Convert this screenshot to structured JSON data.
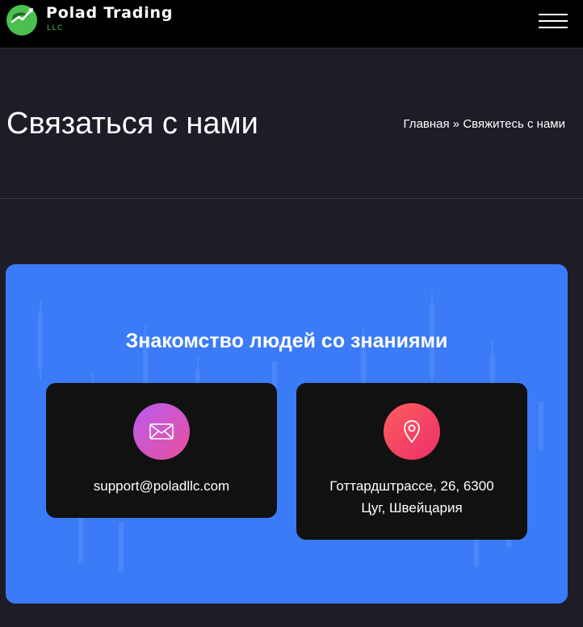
{
  "header": {
    "brand_name": "Polad Trading",
    "brand_sub": "LLC",
    "menu_icon": "hamburger-menu-icon"
  },
  "hero": {
    "title": "Связаться с нами",
    "breadcrumb": {
      "home": "Главная",
      "separator": "»",
      "current": "Свяжитесь с нами"
    }
  },
  "contact": {
    "heading": "Знакомство людей со знаниями",
    "email_card": {
      "icon": "envelope-icon",
      "text": "support@poladllc.com"
    },
    "address_card": {
      "icon": "location-pin-icon",
      "line1": "Готтардштрассе, 26, 6300",
      "line2": "Цуг, Швейцария"
    }
  },
  "colors": {
    "panel_blue": "#3b7bf8",
    "page_bg": "#1d1c27",
    "brand_green": "#4cc04f"
  }
}
